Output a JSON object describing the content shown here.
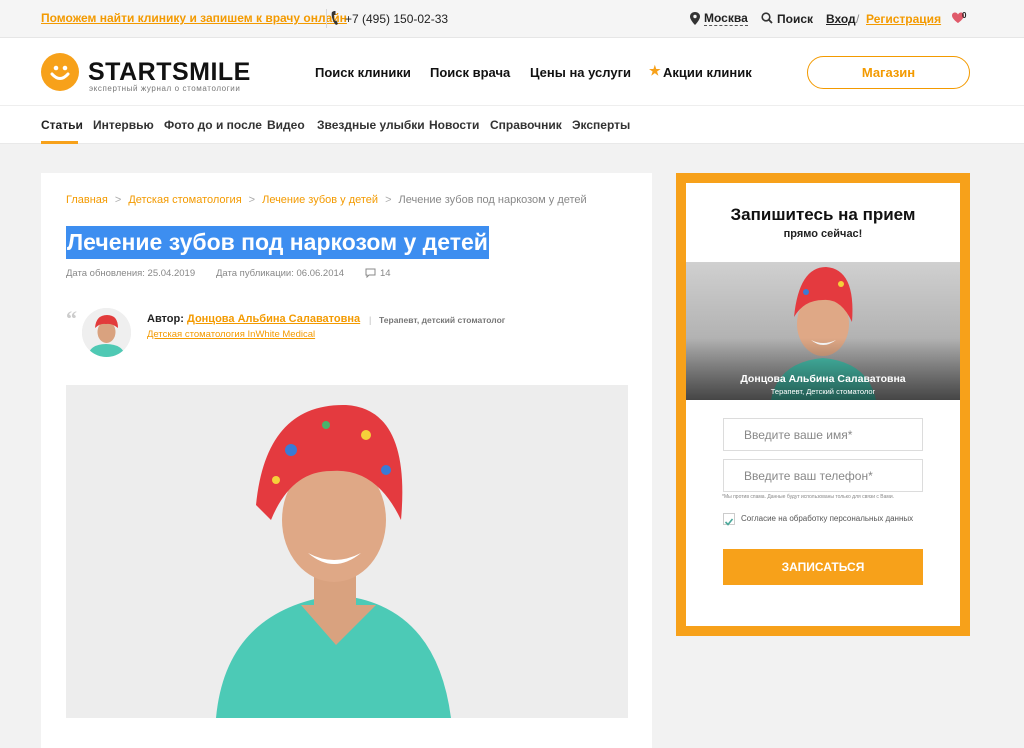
{
  "topbar": {
    "promo": "Поможем найти клинику и запишем к врачу онлайн",
    "phone": "+7 (495) 150-02-33",
    "city": "Москва",
    "search": "Поиск",
    "login": "Вход",
    "slash": "/",
    "register": "Регистрация",
    "favorites_count": "0"
  },
  "header": {
    "logo": "STARTSMILE",
    "tagline": "экспертный журнал о стоматологии",
    "nav": [
      "Поиск клиники",
      "Поиск врача",
      "Цены на услуги",
      "Акции клиник"
    ],
    "star": "★",
    "shop_button": "Магазин"
  },
  "subnav": {
    "items": [
      "Статьи",
      "Интервью",
      "Фото до и после",
      "Видео",
      "Звездные улыбки",
      "Новости",
      "Справочник",
      "Эксперты"
    ],
    "active": "Статьи"
  },
  "article": {
    "breadcrumbs": [
      "Главная",
      "Детская стоматология",
      "Лечение зубов у детей",
      "Лечение зубов под наркозом у детей"
    ],
    "chevron": ">",
    "title": "Лечение зубов под наркозом у детей",
    "updated": "Дата обновления: 25.04.2019",
    "published": "Дата публикации: 06.06.2014",
    "comments": "14",
    "quote_mark": "“",
    "author_prefix": "Автор:",
    "author_name": "Донцова Альбина Салаватовна",
    "author_sep": "|",
    "author_role": "Терапевт, детский стоматолог",
    "author_clinic": "Детская стоматология InWhite Medical"
  },
  "sidebar": {
    "title": "Запишитесь на прием",
    "subtitle": "прямо сейчас!",
    "doctor_name": "Донцова Альбина Салаватовна",
    "doctor_role": "Терапевт, Детский стоматолог",
    "name_placeholder": "Введите ваше имя*",
    "phone_placeholder": "Введите ваш телефон*",
    "fineprint": "*Мы против спама. Данные будут использованы только для связи с Вами.",
    "consent": "Согласие на обработку персональных данных",
    "consent_checked": true,
    "submit": "ЗАПИСАТЬСЯ"
  },
  "colors": {
    "accent": "#f7a11a",
    "link": "#f39a00",
    "selection": "#3d8ef0"
  }
}
